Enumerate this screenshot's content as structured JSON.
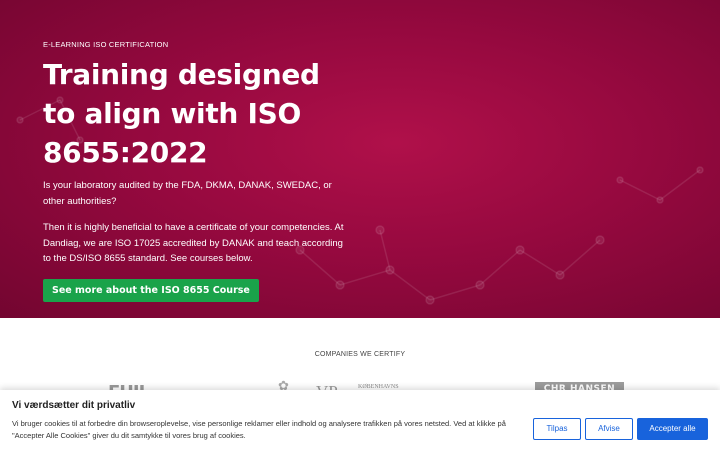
{
  "hero": {
    "eyebrow": "E-LEARNING ISO CERTIFICATION",
    "title": "Training designed to align with ISO 8655:2022",
    "paragraph_1": "Is your laboratory audited by the FDA, DKMA, DANAK, SWEDAC, or other authorities?",
    "paragraph_2": "Then it is highly beneficial to have a certificate of your competencies. At Dandiag, we are ISO 17025 accredited by DANAK and teach according to the DS/ISO 8655 standard. See courses below.",
    "cta_label": "See more about the ISO 8655 Course",
    "colors": {
      "background": "#96093f",
      "cta": "#1aa34a"
    }
  },
  "companies": {
    "title": "COMPANIES WE CERTIFY",
    "logos": [
      {
        "text": "FUJI",
        "icon": "company-logo"
      },
      {
        "text": "✿",
        "icon": "crest-logo"
      },
      {
        "text": "VP",
        "icon": "company-logo"
      },
      {
        "text": "KØBENHAVNS",
        "icon": "university-logo"
      },
      {
        "text": "CHR HANSEN",
        "icon": "company-logo"
      }
    ]
  },
  "cookie_banner": {
    "title": "Vi værdsætter dit privatliv",
    "text": "Vi bruger cookies til at forbedre din browseroplevelse, vise personlige reklamer eller indhold og analysere trafikken på vores netsted. Ved at klikke på \"Accepter Alle Cookies\" giver du dit samtykke til vores brug af cookies.",
    "customize_label": "Tilpas",
    "reject_label": "Afvise",
    "accept_label": "Accepter alle",
    "colors": {
      "primary": "#1863dc"
    }
  }
}
